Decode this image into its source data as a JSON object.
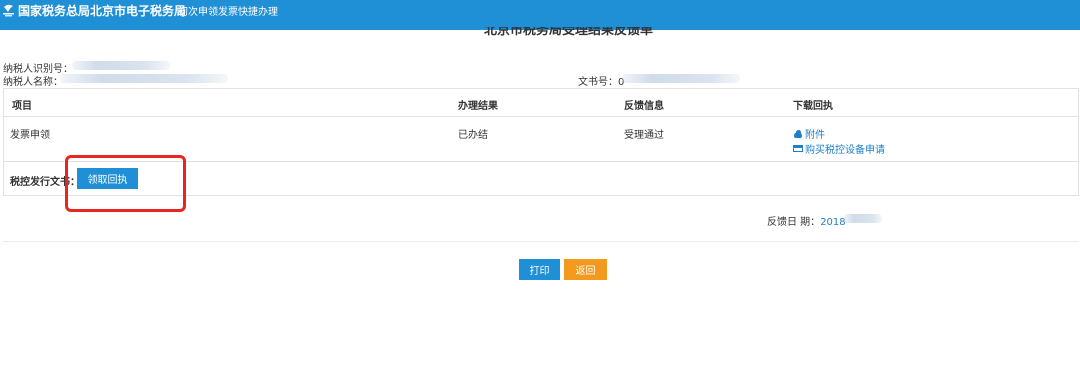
{
  "header": {
    "brand": "国家税务总局北京市电子税务局",
    "subtitle": "初次申领发票快捷办理",
    "bar_color": "#1f8fd6"
  },
  "document": {
    "title": "北京市税务局受理结果反馈单",
    "taxpayer_id_label": "纳税人识别号：",
    "taxpayer_name_label": "纳税人名称：",
    "doc_number_label": "文书号：",
    "doc_number_prefix": "0"
  },
  "table": {
    "headers": [
      "项目",
      "办理结果",
      "反馈信息",
      "下载回执"
    ],
    "rows": [
      {
        "item": "发票申领",
        "result": "已办结",
        "feedback": "受理通过",
        "downloads": [
          {
            "icon": "cloud-download-icon",
            "label": "附件"
          },
          {
            "icon": "device-icon",
            "label": "购买税控设备申请"
          }
        ]
      }
    ],
    "issue_label": "税控发行文书：",
    "receipt_button": "领取回执"
  },
  "feedback": {
    "date_label": "反馈日 期：",
    "date_value": "2018"
  },
  "actions": {
    "print": "打印",
    "back": "返回"
  },
  "colors": {
    "primary": "#1f8fd6",
    "link": "#1f7fc8",
    "back_button": "#f39a1e",
    "highlight": "#e8261f"
  }
}
